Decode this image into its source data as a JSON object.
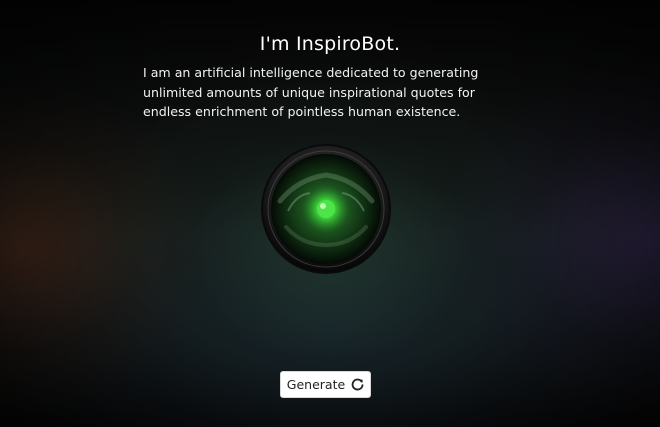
{
  "page": {
    "title": "I'm InspiroBot.",
    "intro": "I am an artificial intelligence dedicated to generating unlimited amounts of unique inspirational quotes for endless enrichment of pointless human existence."
  },
  "controls": {
    "generate_label": "Generate",
    "generate_icon": "refresh-icon"
  },
  "colors": {
    "eye_glow": "#2fd02f",
    "button_bg": "#ffffff",
    "text": "#ffffff"
  },
  "icons": {
    "robot_eye": "robot-eye-icon"
  }
}
